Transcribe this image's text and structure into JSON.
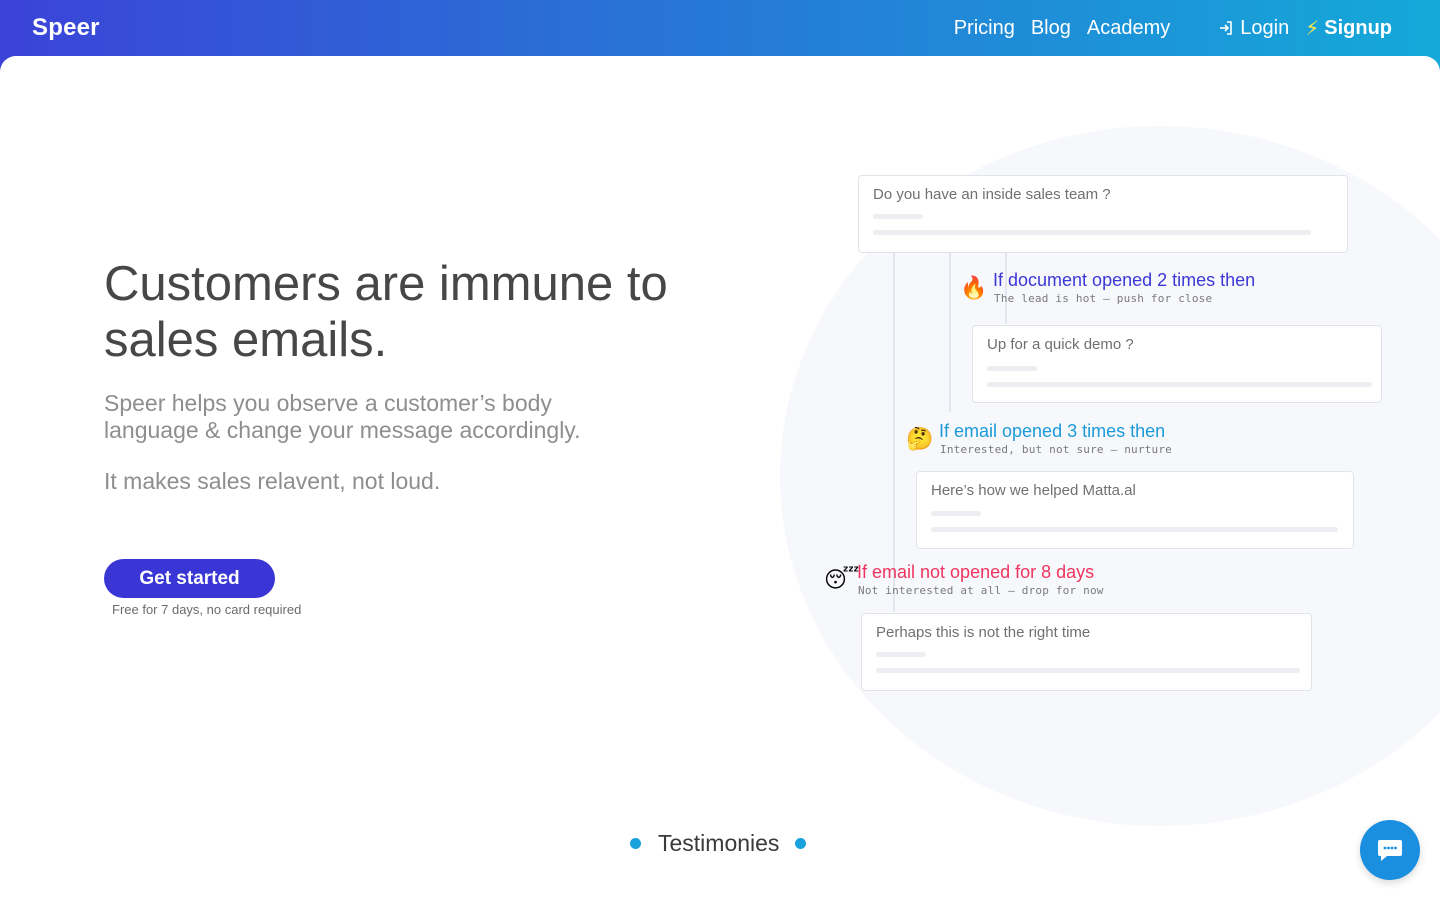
{
  "brand": "Speer",
  "nav": {
    "links": [
      "Pricing",
      "Blog",
      "Academy"
    ],
    "login": "Login",
    "signup": "Signup"
  },
  "hero": {
    "headline": "Customers are immune to sales emails.",
    "sub": "Speer helps you observe a customer’s body language & change your message accordingly.",
    "sub2": "It makes sales relavent, not loud.",
    "cta": "Get started",
    "cta_note": "Free for 7 days, no card required"
  },
  "flow": {
    "cards": [
      "Do you have an inside sales team ?",
      "Up for a quick demo ?",
      "Here’s how we helped Matta.al",
      "Perhaps this is not the right time"
    ],
    "conditions": [
      {
        "emoji": "🔥",
        "text": "If document opened 2 times then",
        "note": "The lead is hot — push for close",
        "color": "#3b38d6"
      },
      {
        "emoji": "🤔",
        "text": "If email opened 3 times then",
        "note": "Interested, but not sure — nurture",
        "color": "#1a9ad8"
      },
      {
        "emoji": "😴",
        "text": "If email not opened for 8 days",
        "note": "Not interested at all — drop for now",
        "color": "#f0345f"
      }
    ]
  },
  "testimonies": "Testimonies",
  "icons": {
    "login": "login-icon",
    "signup": "bolt-icon",
    "chat": "chat-icon"
  },
  "colors": {
    "header_start": "#3b43d8",
    "header_end": "#14a9d9",
    "cta": "#3a36d6",
    "bolt": "#ffe94d",
    "chat": "#1a8fe0"
  }
}
